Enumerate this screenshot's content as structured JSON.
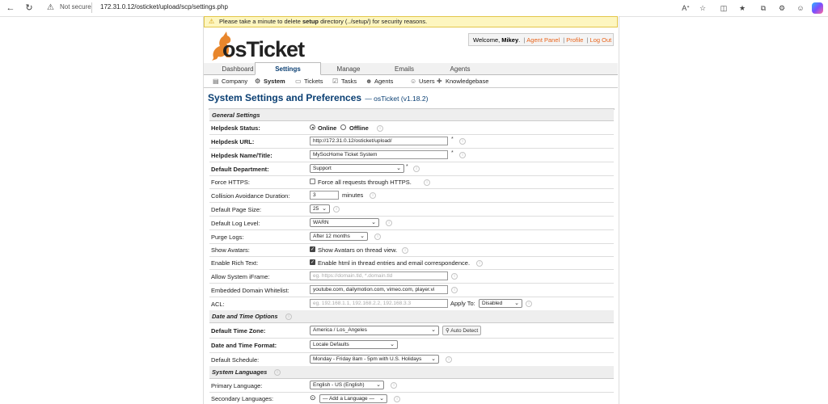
{
  "browser": {
    "security": "Not secure",
    "url": "172.31.0.12/osticket/upload/scp/settings.php"
  },
  "banner": {
    "pre": "Please take a minute to delete ",
    "bold": "setup",
    "post": " directory (../setup/) for security reasons."
  },
  "logo": {
    "text": "osTicket"
  },
  "user": {
    "welcome_prefix": "Welcome, ",
    "name": "Mikey",
    "welcome_suffix": ".",
    "agent_panel": "Agent Panel",
    "profile": "Profile",
    "logout": "Log Out",
    "sep": "|"
  },
  "main_tabs": [
    "Dashboard",
    "Settings",
    "Manage",
    "Emails",
    "Agents"
  ],
  "sub_nav": [
    "Company",
    "System",
    "Tickets",
    "Tasks",
    "Agents",
    "Users",
    "Knowledgebase"
  ],
  "heading": {
    "title": "System Settings and Preferences",
    "version": "— osTicket (v1.18.2)"
  },
  "form": {
    "general": "General Settings",
    "helpdesk_status": {
      "label": "Helpdesk Status:",
      "online": "Online",
      "offline": "Offline"
    },
    "helpdesk_url": {
      "label": "Helpdesk URL:",
      "value": "http://172.31.0.12/osticket/upload/"
    },
    "helpdesk_name": {
      "label": "Helpdesk Name/Title:",
      "value": "MySocHome Ticket System"
    },
    "default_department": {
      "label": "Default Department:",
      "value": "Support"
    },
    "force_https": {
      "label": "Force HTTPS:",
      "text": "Force all requests through HTTPS."
    },
    "collision": {
      "label": "Collision Avoidance Duration:",
      "value": "3",
      "unit": "minutes"
    },
    "page_size": {
      "label": "Default Page Size:",
      "value": "25"
    },
    "log_level": {
      "label": "Default Log Level:",
      "value": "WARN"
    },
    "purge_logs": {
      "label": "Purge Logs:",
      "value": "After 12 months"
    },
    "show_avatars": {
      "label": "Show Avatars:",
      "text": "Show Avatars on thread view."
    },
    "rich_text": {
      "label": "Enable Rich Text:",
      "text": "Enable html in thread entries and email correspondence."
    },
    "iframe": {
      "label": "Allow System iFrame:",
      "placeholder": "eg. https://domain.tld, *.domain.tld"
    },
    "whitelist": {
      "label": "Embedded Domain Whitelist:",
      "value": "youtube.com, dailymotion.com, vimeo.com, player.vi"
    },
    "acl": {
      "label": "ACL:",
      "placeholder": "eg. 192.168.1.1, 192.168.2.2, 192.168.3.3",
      "apply_to": "Apply To:",
      "apply_value": "Disabled"
    },
    "datetime": "Date and Time Options",
    "timezone": {
      "label": "Default Time Zone:",
      "value": "America / Los_Angeles",
      "auto_detect": "Auto Detect"
    },
    "format": {
      "label": "Date and Time Format:",
      "value": "Locale Defaults"
    },
    "schedule": {
      "label": "Default Schedule:",
      "value": "Monday - Friday 8am - 5pm with U.S. Holidays"
    },
    "languages": "System Languages",
    "primary_lang": {
      "label": "Primary Language:",
      "value": "English - US (English)"
    },
    "secondary_lang": {
      "label": "Secondary Languages:",
      "value": "— Add a Language —"
    },
    "required_mark": "*"
  },
  "colors": {
    "accent": "#e8631a",
    "heading": "#0a3f73",
    "banner_bg": "#fdf6c0"
  }
}
